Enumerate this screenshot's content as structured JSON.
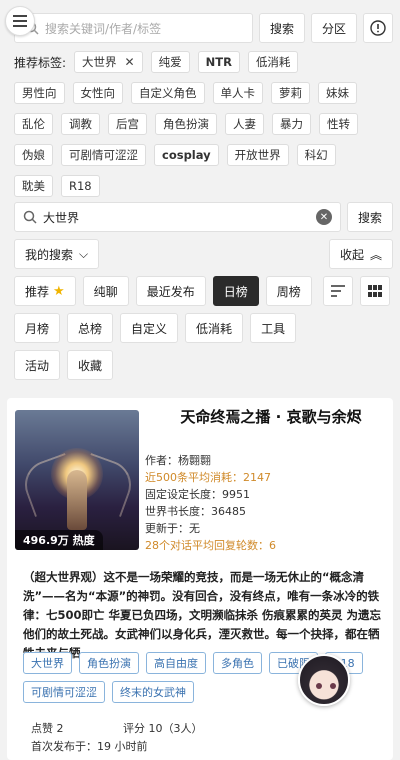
{
  "colors": {
    "accent_dark": "#2b2b2b",
    "tag_blue": "#3a72b0",
    "orange": "#d08a2a",
    "star": "#f0b400"
  },
  "header": {
    "search_placeholder": "搜索关键词/作者/标签",
    "search_button": "搜索",
    "category_button": "分区",
    "info_icon": "!"
  },
  "tags": {
    "label": "推荐标签:",
    "selected": {
      "label": "大世界",
      "remove": "✕"
    },
    "rows": [
      [
        "纯爱",
        "NTR",
        "低消耗"
      ],
      [
        "男性向",
        "女性向",
        "自定义角色",
        "单人卡",
        "萝莉",
        "妹妹"
      ],
      [
        "乱伦",
        "调教",
        "后宫",
        "角色扮演",
        "人妻",
        "暴力",
        "性转"
      ],
      [
        "伪娘",
        "可剧情可涩涩",
        "cosplay",
        "开放世界",
        "科幻"
      ],
      [
        "耽美",
        "R18"
      ]
    ]
  },
  "search2": {
    "value": "大世界",
    "clear": "✕",
    "button": "搜索"
  },
  "my_search": {
    "label": "我的搜索",
    "collapse": "收起"
  },
  "sort_tabs": {
    "recommend": "推荐",
    "row1": [
      "纯聊",
      "最近发布",
      "日榜",
      "周榜"
    ],
    "active": "日榜",
    "row2": [
      "月榜",
      "总榜",
      "自定义",
      "低消耗",
      "工具"
    ],
    "row3": [
      "活动",
      "收藏"
    ]
  },
  "card": {
    "title": "天命终焉之播 · 哀歌与余烬",
    "hot": "496.9万 热度",
    "author": "作者：杨翾翾",
    "avg_tokens": "近500条平均消耗：2147",
    "fixed_len": "固定设定长度：9951",
    "world_len": "世界书长度：36485",
    "updated": "更新于：无",
    "avg_rounds": "28个对话平均回复轮数：6",
    "description": "（超大世界观）这不是一场荣耀的竞技，而是一场无休止的“概念清洗”——名为“本源”的神罚。没有回合，没有终点，唯有一条冰冷的铁律：七500即亡 华夏已负四场，文明濒临抹杀 伤痕累累的英灵 为遗忘他们的故土死战。女武神们以身化兵，湮灭救世。每一个抉择，都在牺牲未来与牺...",
    "tags": [
      "大世界",
      "角色扮演",
      "高自由度",
      "多角色",
      "已破限",
      "R18",
      "可剧情可涩涩",
      "终末的女武神"
    ],
    "likes": "点赞 2",
    "rating": "评分 10（3人）",
    "first_published": "首次发布于：19 小时前"
  }
}
